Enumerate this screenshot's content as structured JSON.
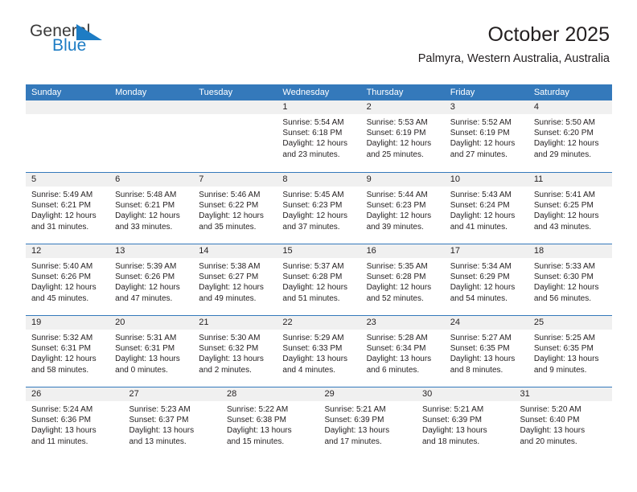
{
  "brand": {
    "name_part1": "General",
    "name_part2": "Blue",
    "flag_icon": "blue-triangle-flag-icon",
    "color_blue": "#1d7cc4",
    "color_dark": "#3a3a3a"
  },
  "header": {
    "title": "October 2025",
    "subtitle": "Palmyra, Western Australia, Australia"
  },
  "theme": {
    "header_bg": "#3479bb",
    "header_text": "#ffffff",
    "daynum_band_bg": "#f0f0f0",
    "rule_color": "#3479bb",
    "text_color": "#231f20"
  },
  "weekdays": [
    "Sunday",
    "Monday",
    "Tuesday",
    "Wednesday",
    "Thursday",
    "Friday",
    "Saturday"
  ],
  "weeks": [
    [
      {
        "day": "",
        "lines": []
      },
      {
        "day": "",
        "lines": []
      },
      {
        "day": "",
        "lines": []
      },
      {
        "day": "1",
        "lines": [
          "Sunrise: 5:54 AM",
          "Sunset: 6:18 PM",
          "Daylight: 12 hours",
          "and 23 minutes."
        ]
      },
      {
        "day": "2",
        "lines": [
          "Sunrise: 5:53 AM",
          "Sunset: 6:19 PM",
          "Daylight: 12 hours",
          "and 25 minutes."
        ]
      },
      {
        "day": "3",
        "lines": [
          "Sunrise: 5:52 AM",
          "Sunset: 6:19 PM",
          "Daylight: 12 hours",
          "and 27 minutes."
        ]
      },
      {
        "day": "4",
        "lines": [
          "Sunrise: 5:50 AM",
          "Sunset: 6:20 PM",
          "Daylight: 12 hours",
          "and 29 minutes."
        ]
      }
    ],
    [
      {
        "day": "5",
        "lines": [
          "Sunrise: 5:49 AM",
          "Sunset: 6:21 PM",
          "Daylight: 12 hours",
          "and 31 minutes."
        ]
      },
      {
        "day": "6",
        "lines": [
          "Sunrise: 5:48 AM",
          "Sunset: 6:21 PM",
          "Daylight: 12 hours",
          "and 33 minutes."
        ]
      },
      {
        "day": "7",
        "lines": [
          "Sunrise: 5:46 AM",
          "Sunset: 6:22 PM",
          "Daylight: 12 hours",
          "and 35 minutes."
        ]
      },
      {
        "day": "8",
        "lines": [
          "Sunrise: 5:45 AM",
          "Sunset: 6:23 PM",
          "Daylight: 12 hours",
          "and 37 minutes."
        ]
      },
      {
        "day": "9",
        "lines": [
          "Sunrise: 5:44 AM",
          "Sunset: 6:23 PM",
          "Daylight: 12 hours",
          "and 39 minutes."
        ]
      },
      {
        "day": "10",
        "lines": [
          "Sunrise: 5:43 AM",
          "Sunset: 6:24 PM",
          "Daylight: 12 hours",
          "and 41 minutes."
        ]
      },
      {
        "day": "11",
        "lines": [
          "Sunrise: 5:41 AM",
          "Sunset: 6:25 PM",
          "Daylight: 12 hours",
          "and 43 minutes."
        ]
      }
    ],
    [
      {
        "day": "12",
        "lines": [
          "Sunrise: 5:40 AM",
          "Sunset: 6:26 PM",
          "Daylight: 12 hours",
          "and 45 minutes."
        ]
      },
      {
        "day": "13",
        "lines": [
          "Sunrise: 5:39 AM",
          "Sunset: 6:26 PM",
          "Daylight: 12 hours",
          "and 47 minutes."
        ]
      },
      {
        "day": "14",
        "lines": [
          "Sunrise: 5:38 AM",
          "Sunset: 6:27 PM",
          "Daylight: 12 hours",
          "and 49 minutes."
        ]
      },
      {
        "day": "15",
        "lines": [
          "Sunrise: 5:37 AM",
          "Sunset: 6:28 PM",
          "Daylight: 12 hours",
          "and 51 minutes."
        ]
      },
      {
        "day": "16",
        "lines": [
          "Sunrise: 5:35 AM",
          "Sunset: 6:28 PM",
          "Daylight: 12 hours",
          "and 52 minutes."
        ]
      },
      {
        "day": "17",
        "lines": [
          "Sunrise: 5:34 AM",
          "Sunset: 6:29 PM",
          "Daylight: 12 hours",
          "and 54 minutes."
        ]
      },
      {
        "day": "18",
        "lines": [
          "Sunrise: 5:33 AM",
          "Sunset: 6:30 PM",
          "Daylight: 12 hours",
          "and 56 minutes."
        ]
      }
    ],
    [
      {
        "day": "19",
        "lines": [
          "Sunrise: 5:32 AM",
          "Sunset: 6:31 PM",
          "Daylight: 12 hours",
          "and 58 minutes."
        ]
      },
      {
        "day": "20",
        "lines": [
          "Sunrise: 5:31 AM",
          "Sunset: 6:31 PM",
          "Daylight: 13 hours",
          "and 0 minutes."
        ]
      },
      {
        "day": "21",
        "lines": [
          "Sunrise: 5:30 AM",
          "Sunset: 6:32 PM",
          "Daylight: 13 hours",
          "and 2 minutes."
        ]
      },
      {
        "day": "22",
        "lines": [
          "Sunrise: 5:29 AM",
          "Sunset: 6:33 PM",
          "Daylight: 13 hours",
          "and 4 minutes."
        ]
      },
      {
        "day": "23",
        "lines": [
          "Sunrise: 5:28 AM",
          "Sunset: 6:34 PM",
          "Daylight: 13 hours",
          "and 6 minutes."
        ]
      },
      {
        "day": "24",
        "lines": [
          "Sunrise: 5:27 AM",
          "Sunset: 6:35 PM",
          "Daylight: 13 hours",
          "and 8 minutes."
        ]
      },
      {
        "day": "25",
        "lines": [
          "Sunrise: 5:25 AM",
          "Sunset: 6:35 PM",
          "Daylight: 13 hours",
          "and 9 minutes."
        ]
      }
    ],
    [
      {
        "day": "26",
        "lines": [
          "Sunrise: 5:24 AM",
          "Sunset: 6:36 PM",
          "Daylight: 13 hours",
          "and 11 minutes."
        ]
      },
      {
        "day": "27",
        "lines": [
          "Sunrise: 5:23 AM",
          "Sunset: 6:37 PM",
          "Daylight: 13 hours",
          "and 13 minutes."
        ]
      },
      {
        "day": "28",
        "lines": [
          "Sunrise: 5:22 AM",
          "Sunset: 6:38 PM",
          "Daylight: 13 hours",
          "and 15 minutes."
        ]
      },
      {
        "day": "29",
        "lines": [
          "Sunrise: 5:21 AM",
          "Sunset: 6:39 PM",
          "Daylight: 13 hours",
          "and 17 minutes."
        ]
      },
      {
        "day": "30",
        "lines": [
          "Sunrise: 5:21 AM",
          "Sunset: 6:39 PM",
          "Daylight: 13 hours",
          "and 18 minutes."
        ]
      },
      {
        "day": "31",
        "lines": [
          "Sunrise: 5:20 AM",
          "Sunset: 6:40 PM",
          "Daylight: 13 hours",
          "and 20 minutes."
        ]
      }
    ]
  ]
}
